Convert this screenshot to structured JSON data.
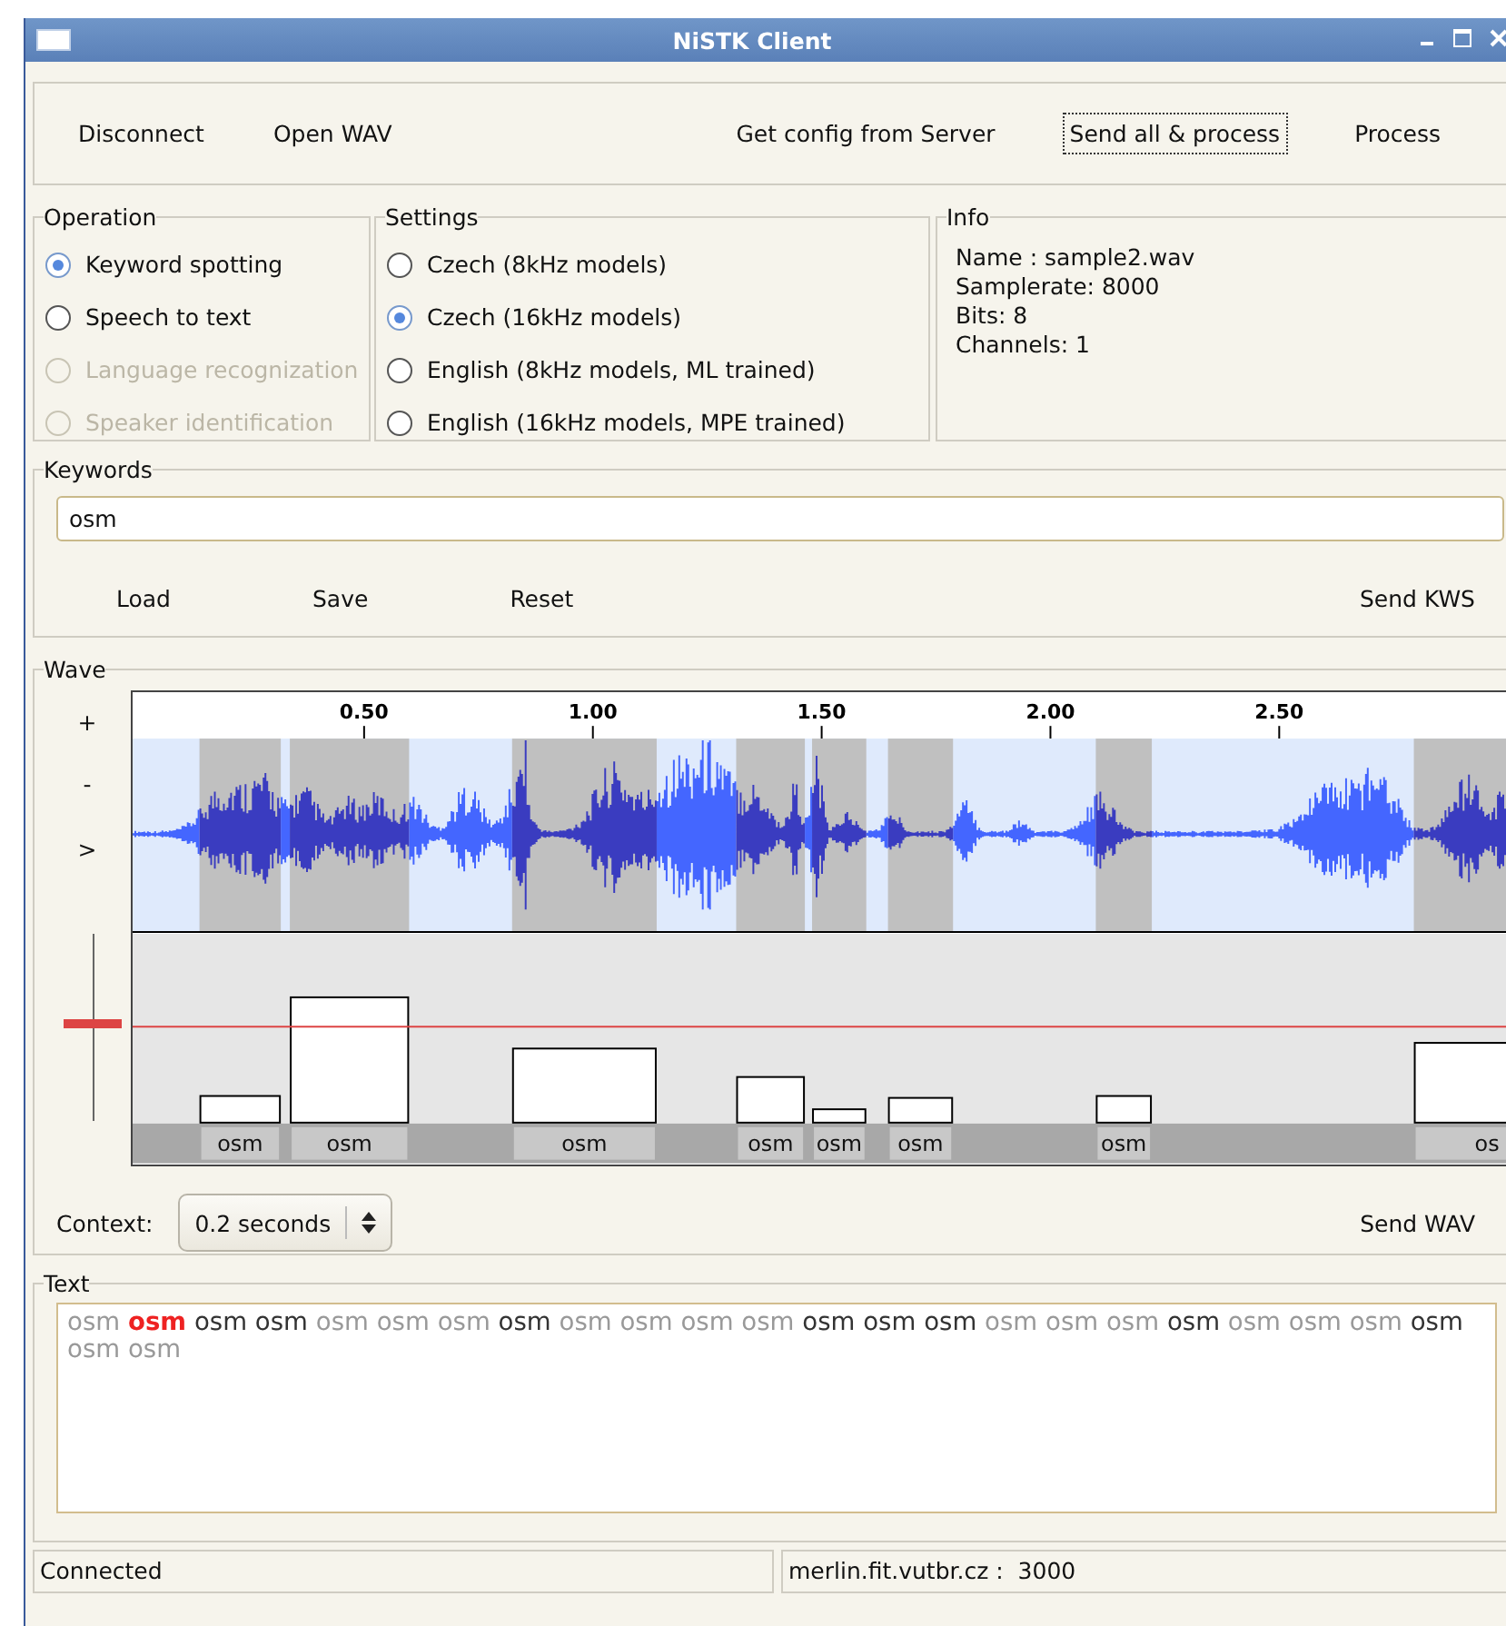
{
  "window": {
    "title": "NiSTK Client"
  },
  "toolbar": {
    "left_buttons": [
      {
        "label": "Disconnect",
        "focused": false
      },
      {
        "label": "Open WAV",
        "focused": false
      }
    ],
    "right_buttons": [
      {
        "label": "Get config from Server",
        "focused": false
      },
      {
        "label": "Send all & process",
        "focused": true
      },
      {
        "label": "Process",
        "focused": false
      }
    ]
  },
  "operation": {
    "title": "Operation",
    "options": [
      {
        "label": "Keyword spotting",
        "selected": true,
        "disabled": false
      },
      {
        "label": "Speech to text",
        "selected": false,
        "disabled": false
      },
      {
        "label": "Language recognization",
        "selected": false,
        "disabled": true
      },
      {
        "label": "Speaker identification",
        "selected": false,
        "disabled": true
      }
    ]
  },
  "settings": {
    "title": "Settings",
    "options": [
      {
        "label": "Czech (8kHz models)",
        "selected": false,
        "disabled": false
      },
      {
        "label": "Czech (16kHz models)",
        "selected": true,
        "disabled": false
      },
      {
        "label": "English (8kHz models, ML trained)",
        "selected": false,
        "disabled": false
      },
      {
        "label": "English (16kHz models, MPE trained)",
        "selected": false,
        "disabled": false
      }
    ]
  },
  "info": {
    "title": "Info",
    "lines": [
      "Name : sample2.wav",
      "Samplerate: 8000",
      "Bits: 8",
      "Channels: 1"
    ]
  },
  "keywords": {
    "title": "Keywords",
    "value": "osm",
    "buttons": [
      "Load",
      "Save",
      "Reset"
    ],
    "send_button": "Send KWS"
  },
  "wave": {
    "title": "Wave",
    "zoom_buttons": [
      "+",
      "-",
      ">"
    ],
    "time_ticks": [
      "0.50",
      "1.00",
      "1.50",
      "2.00",
      "2.50"
    ],
    "threshold": {
      "level": 0.51
    },
    "detections": [
      {
        "label": "osm"
      },
      {
        "label": "osm"
      },
      {
        "label": "osm"
      },
      {
        "label": "osm"
      },
      {
        "label": "osm"
      },
      {
        "label": "osm"
      },
      {
        "label": "osm"
      },
      {
        "label": "os"
      }
    ],
    "context_label": "Context:",
    "context_value": "0.2 seconds",
    "send_button": "Send WAV"
  },
  "text": {
    "title": "Text",
    "words": [
      {
        "text": "osm",
        "kind": "plain"
      },
      {
        "text": "osm",
        "kind": "current"
      },
      {
        "text": "osm",
        "kind": "match"
      },
      {
        "text": "osm",
        "kind": "match"
      },
      {
        "text": "osm",
        "kind": "plain"
      },
      {
        "text": "osm",
        "kind": "plain"
      },
      {
        "text": "osm",
        "kind": "plain"
      },
      {
        "text": "osm",
        "kind": "match"
      },
      {
        "text": "osm",
        "kind": "plain"
      },
      {
        "text": "osm",
        "kind": "plain"
      },
      {
        "text": "osm",
        "kind": "plain"
      },
      {
        "text": "osm",
        "kind": "plain"
      },
      {
        "text": "osm",
        "kind": "match"
      },
      {
        "text": "osm",
        "kind": "match"
      },
      {
        "text": "osm",
        "kind": "match"
      },
      {
        "text": "osm",
        "kind": "plain"
      },
      {
        "text": "osm",
        "kind": "plain"
      },
      {
        "text": "osm",
        "kind": "plain"
      },
      {
        "text": "osm",
        "kind": "match"
      },
      {
        "text": "osm",
        "kind": "plain"
      },
      {
        "text": "osm",
        "kind": "plain"
      },
      {
        "text": "osm",
        "kind": "plain"
      },
      {
        "text": "osm",
        "kind": "match"
      },
      {
        "text": "osm",
        "kind": "plain"
      },
      {
        "text": "osm",
        "kind": "plain"
      }
    ]
  },
  "status_bar": {
    "cells": [
      "Connected",
      "merlin.fit.vutbr.cz :  3000"
    ]
  }
}
